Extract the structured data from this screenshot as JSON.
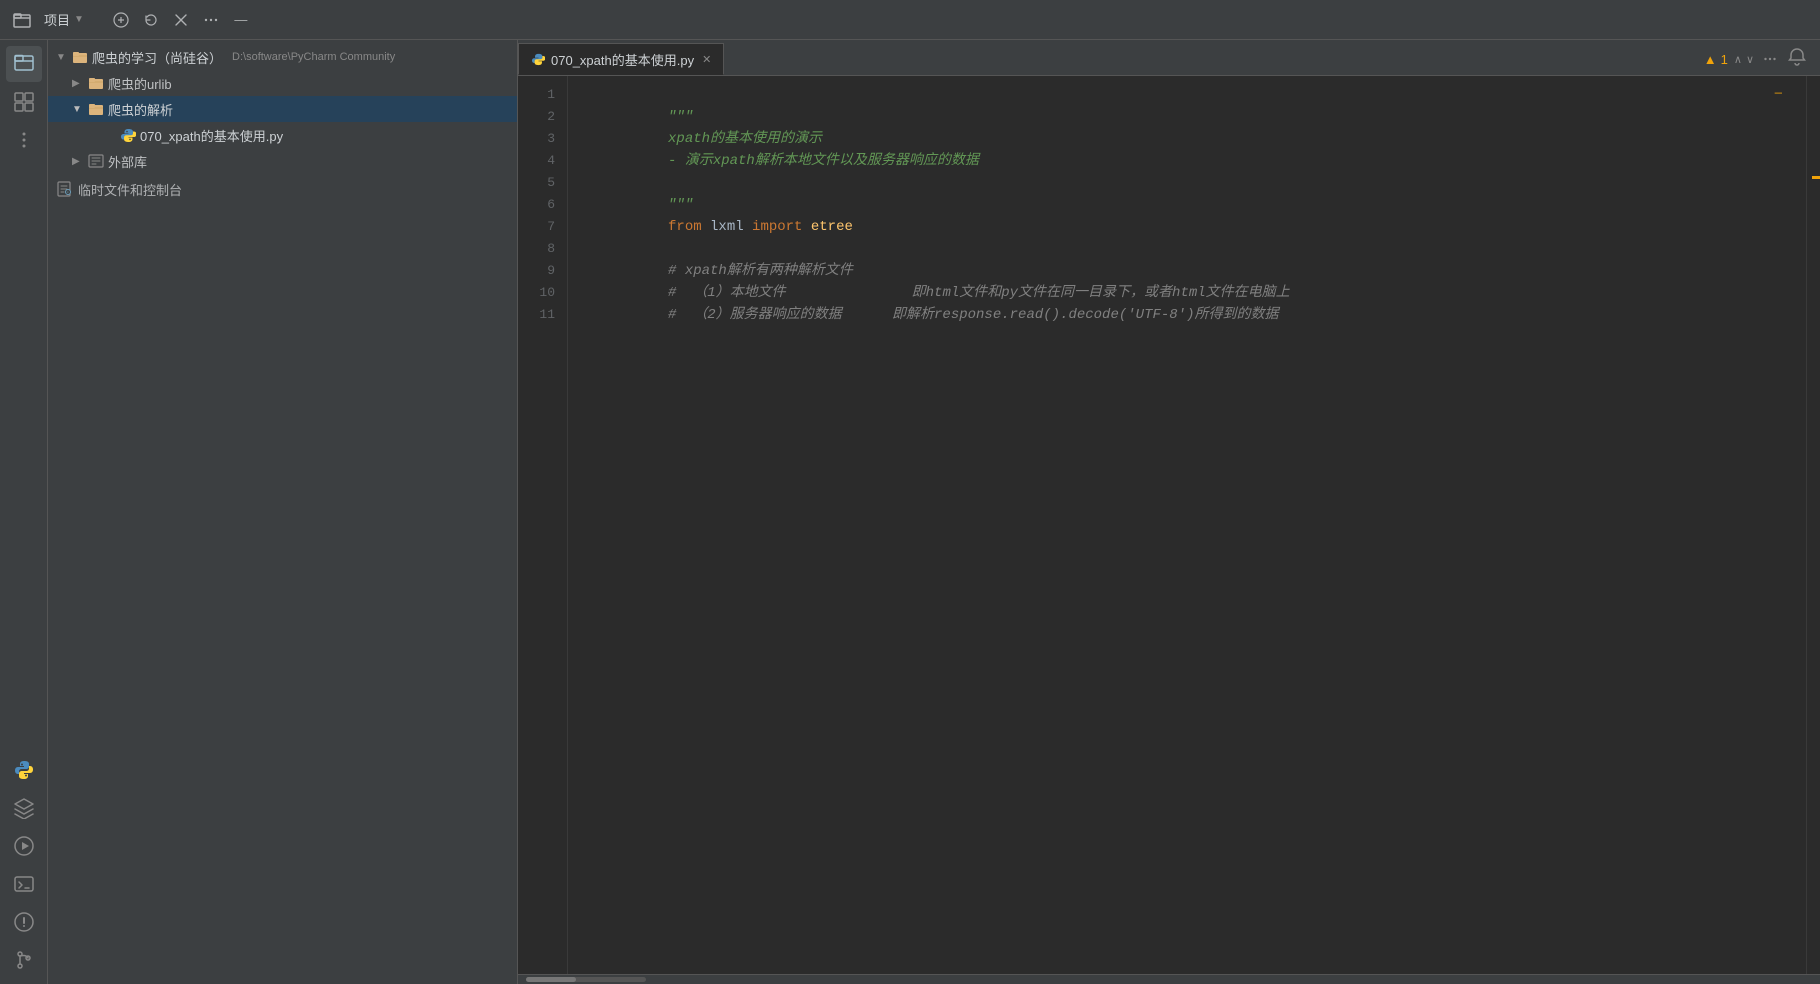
{
  "titlebar": {
    "project_label": "项目",
    "chevron": "∨"
  },
  "toolbar": {
    "add_btn": "⊕",
    "refresh_btn": "↺",
    "close_btn": "✕",
    "more_btn": "⋮",
    "minimize_btn": "—"
  },
  "file_tree": {
    "root": {
      "label": "爬虫的学习（尚硅谷）",
      "path": "D:\\software\\PyCharm Community",
      "expanded": true,
      "children": [
        {
          "id": "urlib",
          "label": "爬虫的urlib",
          "type": "folder",
          "expanded": false
        },
        {
          "id": "jiexi",
          "label": "爬虫的解析",
          "type": "folder",
          "expanded": true,
          "highlighted": true,
          "children": [
            {
              "id": "file1",
              "label": "070_xpath的基本使用.py",
              "type": "python"
            }
          ]
        },
        {
          "id": "external",
          "label": "外部库",
          "type": "external",
          "expanded": false
        }
      ]
    },
    "scratch": "临时文件和控制台"
  },
  "tab": {
    "label": "070_xpath的基本使用.py",
    "close": "✕"
  },
  "warnings": {
    "count": "1",
    "label": "▲ 1",
    "up_arrow": "∧",
    "down_arrow": "∨"
  },
  "code": {
    "lines": [
      {
        "num": 1,
        "content": "\"\"\"",
        "type": "docstring"
      },
      {
        "num": 2,
        "content": "xpath的基本使用的演示",
        "type": "docstring"
      },
      {
        "num": 3,
        "content": "- 演示xpath解析本地文件以及服务器响应的数据",
        "type": "docstring"
      },
      {
        "num": 4,
        "content": "",
        "type": "empty"
      },
      {
        "num": 5,
        "content": "\"\"\"",
        "type": "docstring"
      },
      {
        "num": 6,
        "content": "from lxml import etree",
        "type": "import"
      },
      {
        "num": 7,
        "content": "",
        "type": "empty"
      },
      {
        "num": 8,
        "content": "# xpath解析有两种解析文件",
        "type": "comment"
      },
      {
        "num": 9,
        "content": "#  （1）本地文件               即html文件和py文件在同一目录下，或者html文件在电脑上",
        "type": "comment"
      },
      {
        "num": 10,
        "content": "#  （2）服务器响应的数据      即解析response.read().decode('UTF-8')所得到的数据",
        "type": "comment"
      },
      {
        "num": 11,
        "content": "",
        "type": "empty"
      }
    ]
  },
  "icons": {
    "folder": "📁",
    "arrow_right": "▶",
    "arrow_down": "▼",
    "python": "🐍",
    "external_lib": "📦",
    "scratch": "📋"
  }
}
